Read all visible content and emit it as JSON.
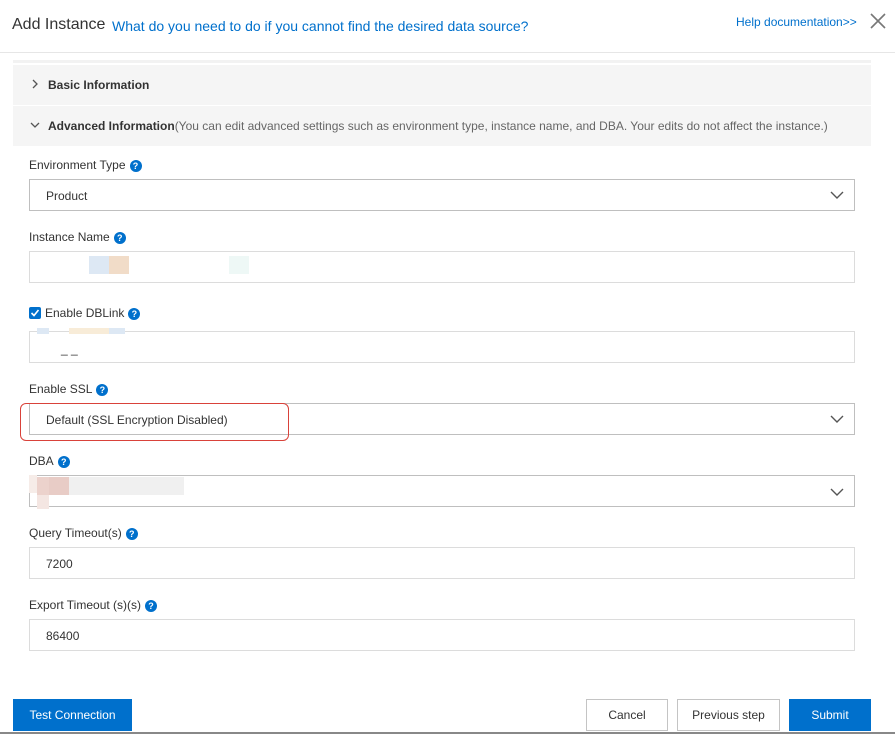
{
  "dialog": {
    "title": "Add Instance",
    "title_link": "What do you need to do if you cannot find the desired data source?",
    "help_link": "Help documentation>>"
  },
  "sections": {
    "basic": {
      "label": "Basic Information"
    },
    "advanced": {
      "label": "Advanced Information",
      "hint": "(You can edit advanced settings such as environment type, instance name, and DBA. Your edits do not affect the instance.)"
    }
  },
  "form": {
    "environment_type": {
      "label": "Environment Type",
      "value": "Product"
    },
    "instance_name": {
      "label": "Instance Name",
      "value": ""
    },
    "enable_dblink": {
      "label": "Enable DBLink",
      "checked": true,
      "value": "_ _"
    },
    "enable_ssl": {
      "label": "Enable SSL",
      "value": "Default (SSL Encryption Disabled)"
    },
    "dba": {
      "label": "DBA",
      "value": ""
    },
    "query_timeout": {
      "label": "Query Timeout(s)",
      "value": "7200"
    },
    "export_timeout": {
      "label": "Export Timeout (s)(s)",
      "value": "86400"
    }
  },
  "buttons": {
    "test_connection": "Test Connection",
    "cancel": "Cancel",
    "previous_step": "Previous step",
    "submit": "Submit"
  },
  "icons": {
    "help": "?",
    "close": "close-icon",
    "chevron": "chevron-icon",
    "caret": "caret-down-icon"
  },
  "colors": {
    "accent": "#0070cc",
    "highlight": "#d9423a",
    "section_bg": "#f5f5f5"
  }
}
